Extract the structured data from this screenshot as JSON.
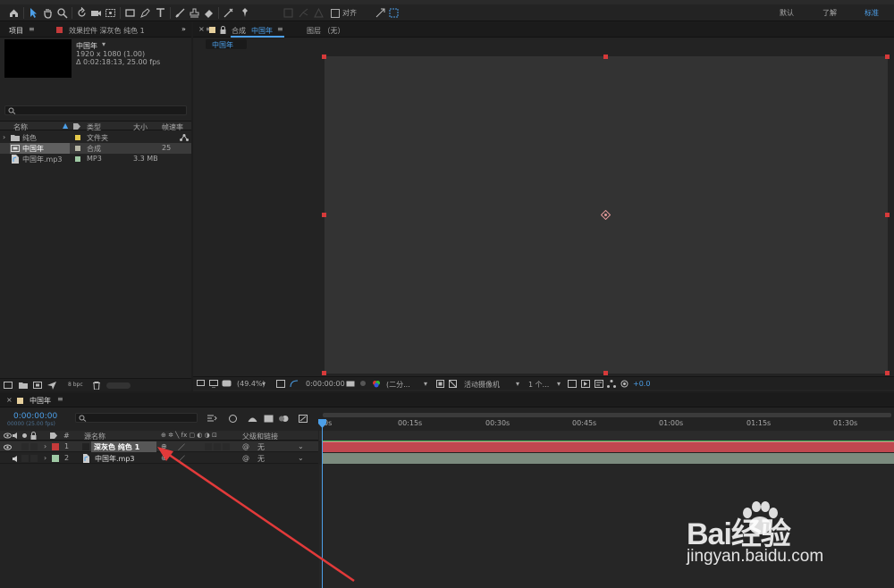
{
  "colors": {
    "accent": "#4c9fe8",
    "layer1_bar": "#c0474f",
    "layer2_bar": "#7b8b7e",
    "handle": "#d63a3a",
    "layer1_label": "#c43a3a",
    "layer2_label": "#9fc9a4"
  },
  "workspaces": {
    "default": "默认",
    "learn": "了解",
    "standard": "标准"
  },
  "toolbar": {
    "snap_label": "对齐"
  },
  "project": {
    "tab": "项目",
    "effects_tab": "效果控件 深灰色 纯色 1",
    "selected_name": "中国年",
    "selected_res": "1920 x 1080 (1.00)",
    "selected_dur": "Δ 0:02:18:13, 25.00 fps",
    "columns": {
      "name": "名称",
      "type": "类型",
      "size": "大小",
      "fps": "帧速率"
    },
    "items": [
      {
        "name": "纯色",
        "type": "文件夹",
        "size": "",
        "fps": ""
      },
      {
        "name": "中国年",
        "type": "合成",
        "size": "",
        "fps": "25"
      },
      {
        "name": "中国年.mp3",
        "type": "MP3",
        "size": "3.3 MB",
        "fps": ""
      }
    ],
    "bpc": "8 bpc"
  },
  "comp": {
    "tab_prefix": "合成",
    "tab_name": "中国年",
    "layer_tab": "图层 （无）",
    "subtab": "中国年",
    "zoom": "(49.4%)",
    "timecode": "0:00:00:00",
    "resolution": "(二分...",
    "camera": "活动摄像机",
    "views": "1 个...",
    "exposure": "+0.0"
  },
  "timeline": {
    "tab": "中国年",
    "timecode": "0:00:00:00",
    "frame_info": "00000 (25.00 fps)",
    "col_source": "源名称",
    "col_num": "#",
    "col_parent": "父级和链接",
    "ruler": [
      "0s",
      "00:15s",
      "00:30s",
      "00:45s",
      "01:00s",
      "01:15s",
      "01:30s"
    ],
    "layers": [
      {
        "num": "1",
        "name": "深灰色 纯色 1",
        "parent": "无"
      },
      {
        "num": "2",
        "name": "中国年.mp3",
        "parent": "无"
      }
    ]
  },
  "watermark": {
    "brand": "Bai经验",
    "url": "jingyan.baidu.com"
  }
}
